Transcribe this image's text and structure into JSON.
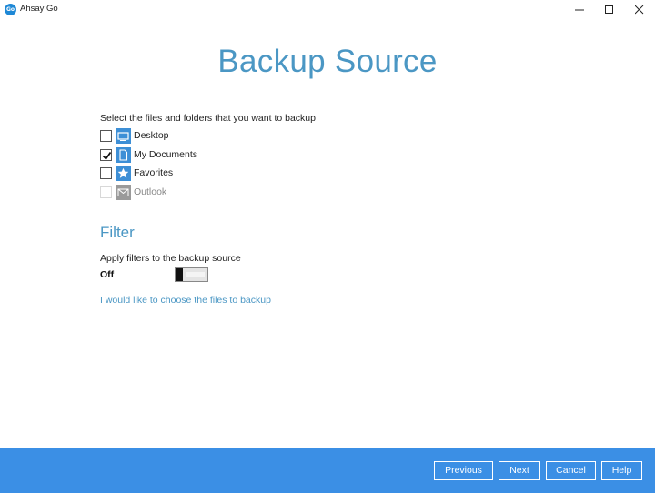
{
  "window": {
    "logo_text": "Go",
    "title": "Ahsay Go"
  },
  "page": {
    "title": "Backup Source",
    "instruction": "Select the files and folders that you want to backup"
  },
  "sources": [
    {
      "label": "Desktop",
      "checked": false,
      "enabled": true,
      "icon": "desktop-icon"
    },
    {
      "label": "My Documents",
      "checked": true,
      "enabled": true,
      "icon": "document-icon"
    },
    {
      "label": "Favorites",
      "checked": false,
      "enabled": true,
      "icon": "star-icon"
    },
    {
      "label": "Outlook",
      "checked": false,
      "enabled": false,
      "icon": "mail-icon"
    }
  ],
  "filter": {
    "heading": "Filter",
    "description": "Apply filters to the backup source",
    "toggle_state": "Off"
  },
  "link": {
    "choose_files": "I would like to choose the files to backup"
  },
  "footer": {
    "previous": "Previous",
    "next": "Next",
    "cancel": "Cancel",
    "help": "Help"
  },
  "colors": {
    "accent": "#4b97c4",
    "footer": "#3b8fe5",
    "icon_blue": "#3d8fd6"
  }
}
